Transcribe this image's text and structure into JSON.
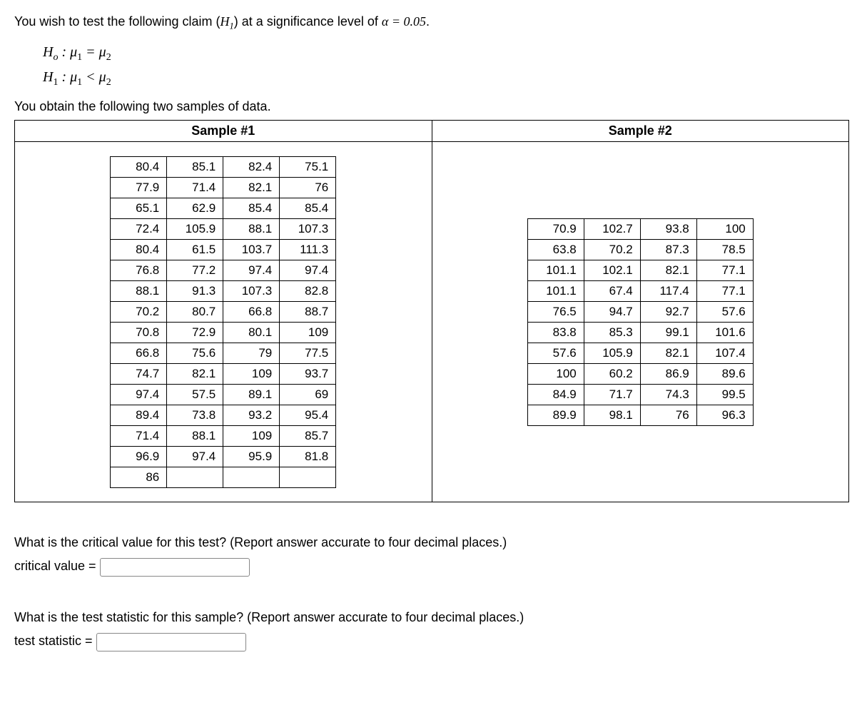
{
  "intro_pre": "You wish to test the following claim (",
  "intro_h1": "H",
  "intro_h1sub": "1",
  "intro_mid": ") at a significance level of ",
  "intro_alpha": "α = 0.05",
  "intro_end": ".",
  "hyp": {
    "h0": "H",
    "h0sub": "o",
    "h0rest": " : μ",
    "h0sub1": "1",
    "h0eq": " = μ",
    "h0sub2": "2",
    "h1": "H",
    "h1sub": "1",
    "h1rest": " : μ",
    "h1sub1": "1",
    "h1lt": " < μ",
    "h1sub2": "2"
  },
  "obtained": "You obtain the following two samples of data.",
  "sample1_label": "Sample #1",
  "sample2_label": "Sample #2",
  "sample1": [
    [
      "80.4",
      "85.1",
      "82.4",
      "75.1"
    ],
    [
      "77.9",
      "71.4",
      "82.1",
      "76"
    ],
    [
      "65.1",
      "62.9",
      "85.4",
      "85.4"
    ],
    [
      "72.4",
      "105.9",
      "88.1",
      "107.3"
    ],
    [
      "80.4",
      "61.5",
      "103.7",
      "111.3"
    ],
    [
      "76.8",
      "77.2",
      "97.4",
      "97.4"
    ],
    [
      "88.1",
      "91.3",
      "107.3",
      "82.8"
    ],
    [
      "70.2",
      "80.7",
      "66.8",
      "88.7"
    ],
    [
      "70.8",
      "72.9",
      "80.1",
      "109"
    ],
    [
      "66.8",
      "75.6",
      "79",
      "77.5"
    ],
    [
      "74.7",
      "82.1",
      "109",
      "93.7"
    ],
    [
      "97.4",
      "57.5",
      "89.1",
      "69"
    ],
    [
      "89.4",
      "73.8",
      "93.2",
      "95.4"
    ],
    [
      "71.4",
      "88.1",
      "109",
      "85.7"
    ],
    [
      "96.9",
      "97.4",
      "95.9",
      "81.8"
    ],
    [
      "86",
      "",
      "",
      ""
    ]
  ],
  "sample2": [
    [
      "70.9",
      "102.7",
      "93.8",
      "100"
    ],
    [
      "63.8",
      "70.2",
      "87.3",
      "78.5"
    ],
    [
      "101.1",
      "102.1",
      "82.1",
      "77.1"
    ],
    [
      "101.1",
      "67.4",
      "117.4",
      "77.1"
    ],
    [
      "76.5",
      "94.7",
      "92.7",
      "57.6"
    ],
    [
      "83.8",
      "85.3",
      "99.1",
      "101.6"
    ],
    [
      "57.6",
      "105.9",
      "82.1",
      "107.4"
    ],
    [
      "100",
      "60.2",
      "86.9",
      "89.6"
    ],
    [
      "84.9",
      "71.7",
      "74.3",
      "99.5"
    ],
    [
      "89.9",
      "98.1",
      "76",
      "96.3"
    ]
  ],
  "q1": "What is the critical value for this test? (Report answer accurate to four decimal places.)",
  "q1_label": "critical value = ",
  "q2": "What is the test statistic for this sample? (Report answer accurate to four decimal places.)",
  "q2_label": "test statistic = "
}
